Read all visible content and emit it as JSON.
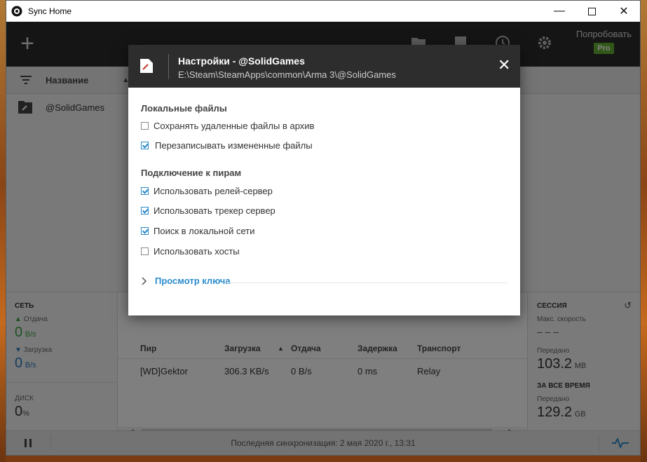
{
  "window": {
    "title": "Sync Home"
  },
  "header": {
    "add": "+",
    "tryout": "Попробовать",
    "pro": "Pro"
  },
  "list": {
    "column_name": "Название",
    "folders": [
      {
        "name": "@SolidGames"
      }
    ]
  },
  "network": {
    "title": "СЕТЬ",
    "upload_label": "Отдача",
    "upload_value": "0",
    "upload_unit": "B/s",
    "download_label": "Загрузка",
    "download_value": "0",
    "download_unit": "B/s",
    "disk_label": "ДИСК",
    "disk_value": "0",
    "disk_unit": "%"
  },
  "peers": {
    "columns": {
      "peer": "Пир",
      "download": "Загрузка",
      "upload": "Отдача",
      "latency": "Задержка",
      "transport": "Транспорт"
    },
    "rows": [
      {
        "peer": "[WD]Gektor",
        "download": "306.3 KB/s",
        "upload": "0 B/s",
        "latency": "0 ms",
        "transport": "Relay"
      }
    ]
  },
  "session": {
    "title": "СЕССИЯ",
    "max_speed_label": "Макс. скорость",
    "max_speed_value": "– – –",
    "transferred_label": "Передано",
    "transferred_value": "103.2",
    "transferred_unit": "MB",
    "all_time_title": "ЗА ВСЕ ВРЕМЯ",
    "all_time_label": "Передано",
    "all_time_value": "129.2",
    "all_time_unit": "GB"
  },
  "status": {
    "last_sync": "Последняя синхронизация: 2 мая 2020 г., 13:31"
  },
  "dialog": {
    "title": "Настройки - @SolidGames",
    "path": "E:\\Steam\\SteamApps\\common\\Arma 3\\@SolidGames",
    "local_files": {
      "heading": "Локальные файлы",
      "options": [
        {
          "label": "Сохранять удаленные файлы в архив",
          "checked": false
        },
        {
          "label": "Перезаписывать измененные файлы",
          "checked": true
        }
      ]
    },
    "peer_connection": {
      "heading": "Подключение к пирам",
      "options": [
        {
          "label": "Использовать релей-сервер",
          "checked": true
        },
        {
          "label": "Использовать трекер сервер",
          "checked": true
        },
        {
          "label": "Поиск в локальной сети",
          "checked": true
        },
        {
          "label": "Использовать хосты",
          "checked": false
        }
      ]
    },
    "view_key": "Просмотр ключа"
  },
  "colors": {
    "accent": "#2a8ccd",
    "pro": "#64b032",
    "upload": "#3aa344",
    "download": "#2b7bbd",
    "header": "#2b2b2b"
  }
}
